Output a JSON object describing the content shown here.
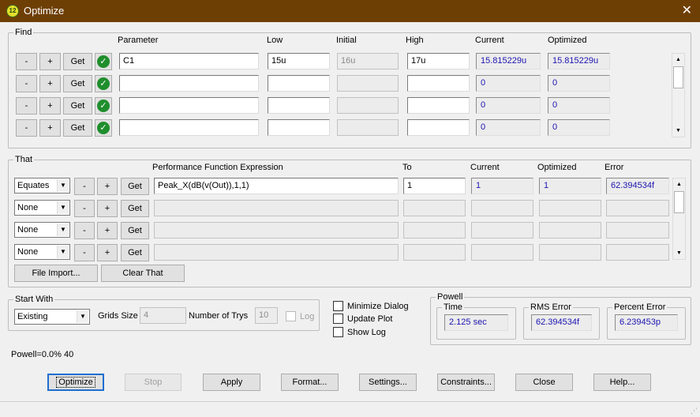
{
  "window": {
    "title": "Optimize",
    "icon_text": "12",
    "close": "✕"
  },
  "find": {
    "label": "Find",
    "headers": {
      "parameter": "Parameter",
      "low": "Low",
      "initial": "Initial",
      "high": "High",
      "current": "Current",
      "optimized": "Optimized"
    },
    "buttons": {
      "minus": "-",
      "plus": "+",
      "get": "Get"
    },
    "rows": [
      {
        "parameter": "C1",
        "low": "15u",
        "initial": "16u",
        "high": "17u",
        "current": "15.815229u",
        "optimized": "15.815229u"
      },
      {
        "parameter": "",
        "low": "",
        "initial": "",
        "high": "",
        "current": "0",
        "optimized": "0"
      },
      {
        "parameter": "",
        "low": "",
        "initial": "",
        "high": "",
        "current": "0",
        "optimized": "0"
      },
      {
        "parameter": "",
        "low": "",
        "initial": "",
        "high": "",
        "current": "0",
        "optimized": "0"
      }
    ]
  },
  "that": {
    "label": "That",
    "headers": {
      "expression": "Performance Function Expression",
      "to": "To",
      "current": "Current",
      "optimized": "Optimized",
      "error": "Error"
    },
    "buttons": {
      "minus": "-",
      "plus": "+",
      "get": "Get"
    },
    "rows": [
      {
        "mode": "Equates",
        "expression": "Peak_X(dB(v(Out)),1,1)",
        "to": "1",
        "current": "1",
        "optimized": "1",
        "error": "62.394534f"
      },
      {
        "mode": "None",
        "expression": "",
        "to": "",
        "current": "",
        "optimized": "",
        "error": ""
      },
      {
        "mode": "None",
        "expression": "",
        "to": "",
        "current": "",
        "optimized": "",
        "error": ""
      },
      {
        "mode": "None",
        "expression": "",
        "to": "",
        "current": "",
        "optimized": "",
        "error": ""
      }
    ],
    "file_import": "File Import...",
    "clear_that": "Clear That"
  },
  "start_with": {
    "label": "Start With",
    "value": "Existing",
    "grids_size_label": "Grids Size",
    "grids_size_value": "4",
    "trys_label": "Number of Trys",
    "trys_value": "10",
    "log_label": "Log"
  },
  "options": {
    "minimize_dialog": "Minimize Dialog",
    "update_plot": "Update Plot",
    "show_log": "Show Log"
  },
  "powell": {
    "label": "Powell",
    "time_label": "Time",
    "time_value": "2.125 sec",
    "rms_label": "RMS Error",
    "rms_value": "62.394534f",
    "percent_label": "Percent Error",
    "percent_value": "6.239453p"
  },
  "status_text": "Powell=0.0% 40",
  "actions": {
    "optimize": "Optimize",
    "stop": "Stop",
    "apply": "Apply",
    "format": "Format...",
    "settings": "Settings...",
    "constraints": "Constraints...",
    "close": "Close",
    "help": "Help..."
  },
  "colors": {
    "titlebar": "#6e3f05",
    "readout_text": "#1c14b0",
    "check_green": "#1f8e2c",
    "focus_border": "#1f6fd0"
  }
}
